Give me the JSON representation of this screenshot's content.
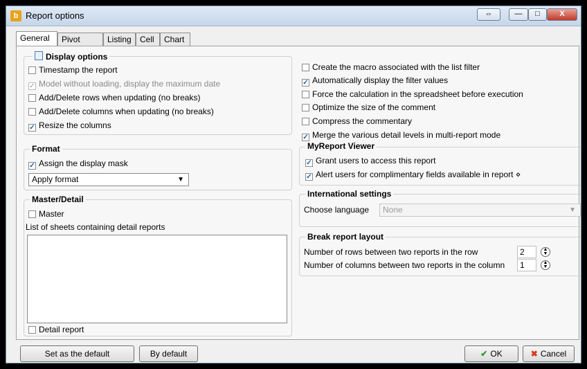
{
  "window": {
    "title": "Report options",
    "app_icon": "b",
    "controls": {
      "restore": "⇔",
      "minimize": "—",
      "maximize": "□",
      "close": "X"
    }
  },
  "tabs": [
    "General",
    "Pivot Table",
    "Listing",
    "Cell",
    "Chart"
  ],
  "display_options": {
    "title": "Display options",
    "items": [
      {
        "label": "Timestamp the report",
        "checked": false
      },
      {
        "label": "Model without loading, display the maximum date",
        "checked": true,
        "disabled": true
      },
      {
        "label": "Add/Delete rows when updating (no breaks)",
        "checked": false
      },
      {
        "label": "Add/Delete columns when updating (no breaks)",
        "checked": false
      },
      {
        "label": "Resize the columns",
        "checked": true
      }
    ]
  },
  "right_options": [
    {
      "label": "Create the macro associated with the list filter",
      "checked": false
    },
    {
      "label": "Automatically display the filter values",
      "checked": true
    },
    {
      "label": "Force the calculation in the spreadsheet before execution",
      "checked": false
    },
    {
      "label": "Optimize the size of the comment",
      "checked": false
    },
    {
      "label": "Compress the commentary",
      "checked": false
    },
    {
      "label": "Merge the various detail levels in multi-report mode",
      "checked": true
    }
  ],
  "format": {
    "title": "Format",
    "assign_mask": {
      "label": "Assign the display mask",
      "checked": true
    },
    "select_value": "Apply format"
  },
  "master_detail": {
    "title": "Master/Detail",
    "master": {
      "label": "Master",
      "checked": false
    },
    "list_label": "List of sheets containing detail reports",
    "detail": {
      "label": "Detail report",
      "checked": false
    }
  },
  "viewer": {
    "title": "MyReport Viewer",
    "items": [
      {
        "label": "Grant users to access this report",
        "checked": true
      },
      {
        "label": "Alert users for complimentary fields available in report ⋄",
        "checked": true
      }
    ]
  },
  "international": {
    "title": "International settings",
    "label": "Choose language",
    "value": "None"
  },
  "break_layout": {
    "title": "Break report layout",
    "rows_label": "Number of rows between two reports in the row",
    "rows_value": "2",
    "cols_label": "Number of columns between two reports in the column",
    "cols_value": "1"
  },
  "buttons": {
    "set_default": "Set as the default",
    "by_default": "By default",
    "ok": "OK",
    "cancel": "Cancel"
  }
}
